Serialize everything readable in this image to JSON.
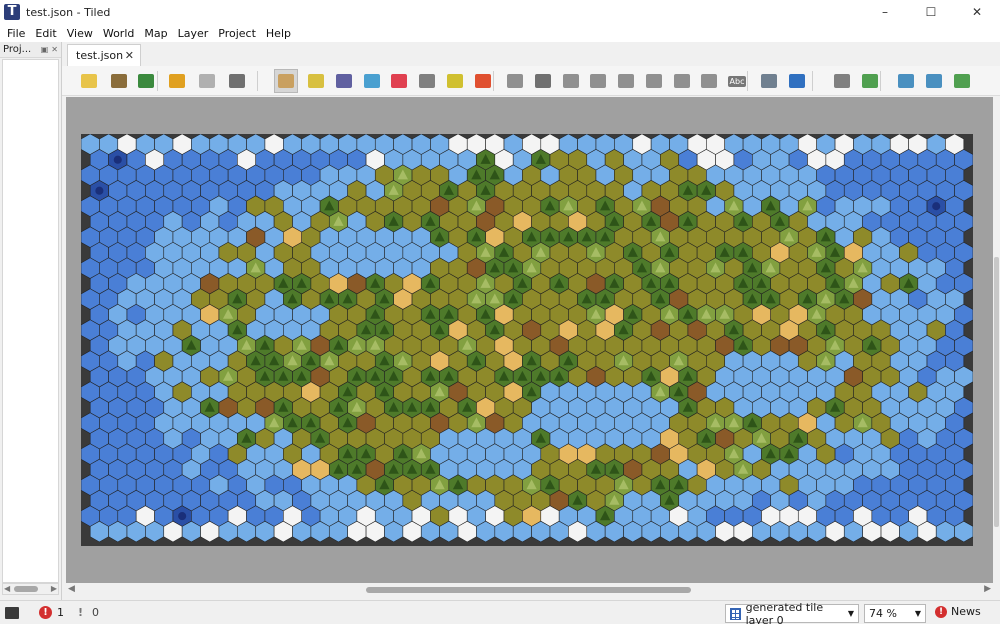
{
  "window": {
    "title": "test.json - Tiled",
    "app_icon_letter": "T",
    "minimize": "–",
    "maximize": "☐",
    "close": "✕"
  },
  "menu": [
    "File",
    "Edit",
    "View",
    "World",
    "Map",
    "Layer",
    "Project",
    "Help"
  ],
  "project_panel": {
    "title": "Proj..."
  },
  "document_tab": {
    "label": "test.json",
    "close": "✕"
  },
  "toolbar": {
    "tools": [
      {
        "name": "new-map",
        "color": "#e8c44a"
      },
      {
        "name": "open",
        "color": "#8a6d3b"
      },
      {
        "name": "save",
        "color": "#3b8a3e"
      },
      {
        "name": "undo",
        "color": "#e0a020"
      },
      {
        "name": "redo",
        "color": "#b0b0b0"
      },
      {
        "name": "commands",
        "color": "#707070"
      },
      {
        "name": "stamp-brush",
        "color": "#c9a060",
        "active": true
      },
      {
        "name": "terrain-brush",
        "color": "#d8c040"
      },
      {
        "name": "bucket-fill",
        "color": "#6060a0"
      },
      {
        "name": "shape-fill",
        "color": "#4aa0d0"
      },
      {
        "name": "eraser",
        "color": "#e04050"
      },
      {
        "name": "rect-select",
        "color": "#808080"
      },
      {
        "name": "magic-wand",
        "color": "#d0c030"
      },
      {
        "name": "select-same",
        "color": "#e05030"
      },
      {
        "name": "select-objects",
        "color": "#909090"
      },
      {
        "name": "edit-polygons",
        "color": "#707070"
      },
      {
        "name": "insert-rectangle",
        "color": "#909090"
      },
      {
        "name": "insert-point",
        "color": "#909090"
      },
      {
        "name": "insert-ellipse",
        "color": "#909090"
      },
      {
        "name": "insert-polygon",
        "color": "#909090"
      },
      {
        "name": "insert-tile",
        "color": "#909090"
      },
      {
        "name": "insert-template",
        "color": "#909090"
      },
      {
        "name": "insert-text",
        "color": "#909090"
      },
      {
        "name": "world-tool",
        "color": "#708090"
      },
      {
        "name": "move-tool",
        "color": "#3070c0"
      },
      {
        "name": "random-mode",
        "color": "#808080"
      },
      {
        "name": "wang-fill",
        "color": "#50a050"
      },
      {
        "name": "flip-horizontal",
        "color": "#4a90c0"
      },
      {
        "name": "flip-vertical",
        "color": "#4a90c0"
      },
      {
        "name": "rotate",
        "color": "#50a050"
      }
    ],
    "text_tool_label": "Abc"
  },
  "map": {
    "columns": 48,
    "rows": 26,
    "terrain_colors": {
      "ocean": "#4a7fd6",
      "shallow": "#74aee8",
      "grass": "#8e8a2a",
      "forest": "#4e7a2a",
      "hills": "#82a040",
      "sand": "#e6b860",
      "dirt": "#8a5a28",
      "snow": "#f4f4f4",
      "deep": "#2a4fa6"
    },
    "grid_color": "#222222"
  },
  "status": {
    "error_count": "1",
    "warning_count": "0",
    "error_glyph": "!",
    "warning_glyph": "!",
    "layer": "generated tile layer 0",
    "zoom": "74 %",
    "news": "News"
  }
}
